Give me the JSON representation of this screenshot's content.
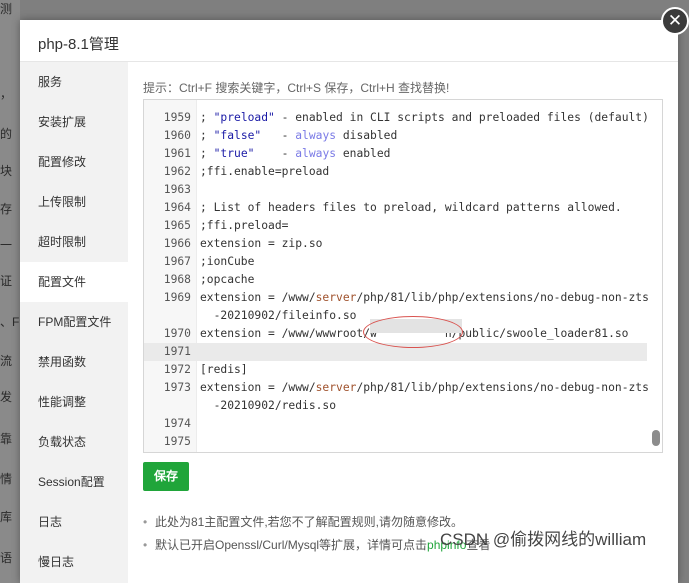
{
  "background_fragments": [
    "测",
    "，",
    "的",
    "块",
    "存",
    "一",
    "证",
    "、F",
    "流",
    "发",
    "靠",
    "情",
    "库",
    "语"
  ],
  "dialog": {
    "title": "php-8.1管理",
    "close_icon": "close-icon"
  },
  "sidebar": {
    "items": [
      {
        "label": "服务"
      },
      {
        "label": "安装扩展"
      },
      {
        "label": "配置修改"
      },
      {
        "label": "上传限制"
      },
      {
        "label": "超时限制"
      },
      {
        "label": "配置文件",
        "active": true
      },
      {
        "label": "FPM配置文件"
      },
      {
        "label": "禁用函数"
      },
      {
        "label": "性能调整"
      },
      {
        "label": "负载状态"
      },
      {
        "label": "Session配置"
      },
      {
        "label": "日志"
      },
      {
        "label": "慢日志"
      }
    ]
  },
  "hint": "提示：Ctrl+F 搜索关键字，Ctrl+S 保存，Ctrl+H 查找替换!",
  "editor": {
    "lines": [
      {
        "n": "1959",
        "pre": "; ",
        "str": "\"preload\"",
        "mid": " - enabled in CLI scripts and preloaded files (default)"
      },
      {
        "n": "1960",
        "pre": "; ",
        "str": "\"false\"",
        "mid": "   - ",
        "kw": "always",
        "post": " disabled"
      },
      {
        "n": "1961",
        "pre": "; ",
        "str": "\"true\"",
        "mid": "    - ",
        "kw": "always",
        "post": " enabled"
      },
      {
        "n": "1962",
        "text": ";ffi.enable=preload"
      },
      {
        "n": "1963",
        "text": ""
      },
      {
        "n": "1964",
        "text": "; List of headers files to preload, wildcard patterns allowed."
      },
      {
        "n": "1965",
        "text": ";ffi.preload="
      },
      {
        "n": "1966",
        "text": "extension = zip.so"
      },
      {
        "n": "1967",
        "text": ";ionCube"
      },
      {
        "n": "1968",
        "text": ";opcache"
      },
      {
        "n": "1969",
        "pre": "extension = /www/",
        "path": "server",
        "mid": "/php/81/lib/php/extensions/no-debug-non-zts"
      },
      {
        "n": "",
        "text": "  -20210902/fileinfo.so"
      },
      {
        "n": "1970",
        "text": "extension = /www/wwwroot/w          n/public/swoole_loader81.so"
      },
      {
        "n": "1971",
        "text": "",
        "active": true
      },
      {
        "n": "1972",
        "text": "[redis]"
      },
      {
        "n": "1973",
        "pre": "extension = /www/",
        "path": "server",
        "mid": "/php/81/lib/php/extensions/no-debug-non-zts"
      },
      {
        "n": "",
        "text": "  -20210902/redis.so"
      },
      {
        "n": "1974",
        "text": ""
      },
      {
        "n": "1975",
        "text": ""
      }
    ]
  },
  "save_label": "保存",
  "notes": {
    "note1": "此处为81主配置文件,若您不了解配置规则,请勿随意修改。",
    "note2_before": "默认已开启Openssl/Curl/Mysql等扩展，详情可点击",
    "note2_link": "phpinfo",
    "note2_after": "查看"
  },
  "watermark": "CSDN @偷拨网线的william"
}
